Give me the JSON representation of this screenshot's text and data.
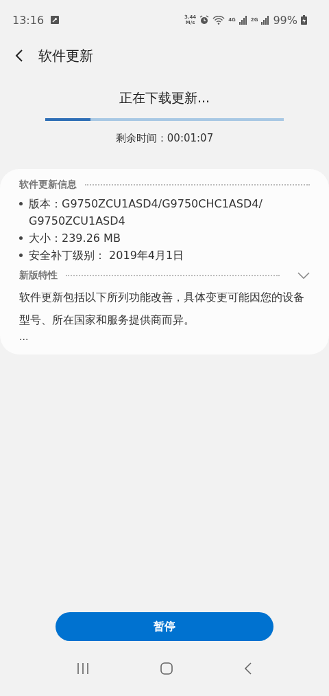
{
  "status_bar": {
    "time": "13:16",
    "speed_value": "3.44",
    "speed_unit": "M/s",
    "network_1": "4G",
    "network_2": "2G",
    "battery": "99%"
  },
  "header": {
    "title": "软件更新"
  },
  "download": {
    "status": "正在下载更新...",
    "level": 0.19,
    "remaining": "剩余时间：00:01:07"
  },
  "info": {
    "title": "软件更新信息",
    "items": [
      {
        "lines": [
          "版本：G9750ZCU1ASD4/G9750CHC1ASD4/",
          "G9750ZCU1ASD4"
        ]
      },
      {
        "lines": [
          "大小：239.26 MB"
        ]
      },
      {
        "lines": [
          "安全补丁级别： 2019年4月1日"
        ]
      }
    ],
    "features_title": "新版特性",
    "features_expanded": false,
    "features_text": "软件更新包括以下所列功能改善，具体变更可能因您的设备型号、所在国家和服务提供商而异。",
    "more": "..."
  },
  "pause_button": "暂停"
}
